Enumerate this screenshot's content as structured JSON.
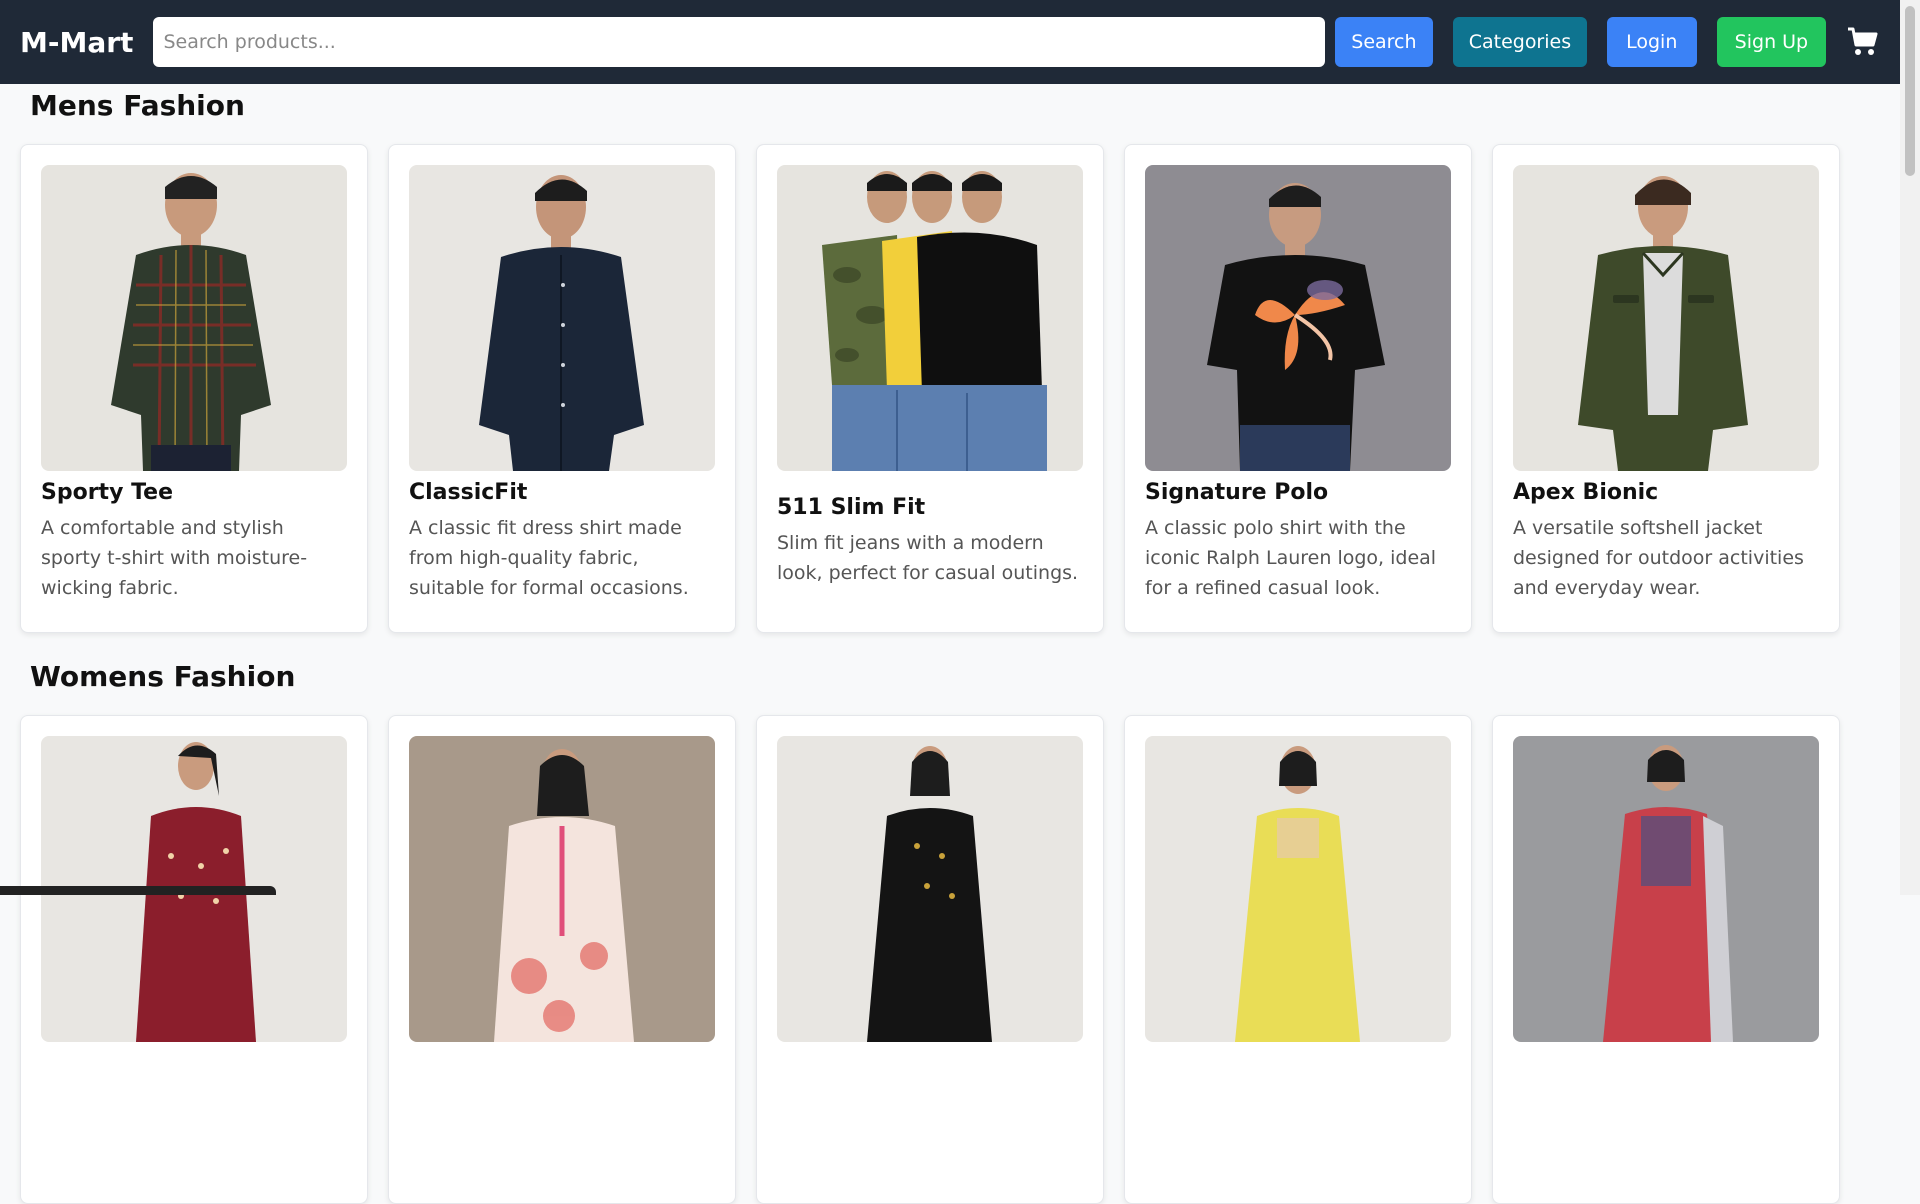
{
  "header": {
    "brand": "M-Mart",
    "search_placeholder": "Search products...",
    "search_label": "Search",
    "categories_label": "Categories",
    "login_label": "Login",
    "signup_label": "Sign Up",
    "cart_icon": "shopping-cart-icon"
  },
  "sections": [
    {
      "title": "Mens Fashion",
      "products": [
        {
          "name": "Sporty Tee",
          "description": "A comfortable and stylish sporty t-shirt with moisture-wicking fabric."
        },
        {
          "name": "ClassicFit",
          "description": "A classic fit dress shirt made from high-quality fabric, suitable for formal occasions."
        },
        {
          "name": "511 Slim Fit",
          "description": "Slim fit jeans with a modern look, perfect for casual outings."
        },
        {
          "name": "Signature Polo",
          "description": "A classic polo shirt with the iconic Ralph Lauren logo, ideal for a refined casual look."
        },
        {
          "name": "Apex Bionic",
          "description": "A versatile softshell jacket designed for outdoor activities and everyday wear."
        }
      ]
    },
    {
      "title": "Womens Fashion",
      "products": [
        {
          "name": "",
          "description": ""
        },
        {
          "name": "",
          "description": ""
        },
        {
          "name": "",
          "description": ""
        },
        {
          "name": "",
          "description": ""
        },
        {
          "name": "",
          "description": ""
        }
      ]
    }
  ],
  "colors": {
    "navbar": "#1f2937",
    "search_button": "#3b82f6",
    "categories_button": "#0e7490",
    "login_button": "#3b82f6",
    "signup_button": "#22c55e"
  }
}
